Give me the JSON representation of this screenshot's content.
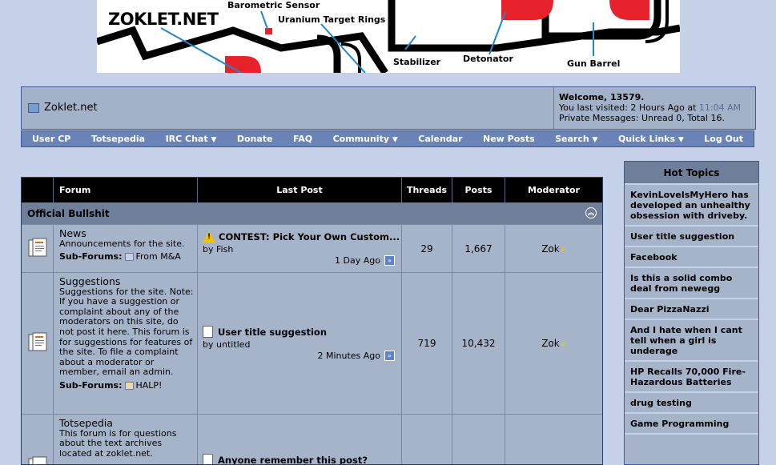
{
  "banner": {
    "site_title": "ZOKLET.NET",
    "labels": [
      "Barometric Sensor",
      "Uranium Target Rings",
      "Stabilizer",
      "Detonator",
      "Gun Barrel"
    ]
  },
  "header": {
    "site_name": "Zoklet.net",
    "welcome": "Welcome, 13579.",
    "last_visited_prefix": "You last visited: 2 Hours Ago at",
    "last_visited_time": "11:04 AM",
    "private_messages": "Private Messages: Unread 0, Total 16."
  },
  "nav": {
    "items": [
      "User CP",
      "Totsepedia",
      "IRC Chat",
      "Donate",
      "FAQ",
      "Community",
      "Calendar",
      "New Posts",
      "Search",
      "Quick Links",
      "Log Out"
    ]
  },
  "table": {
    "columns": [
      "Forum",
      "Last Post",
      "Threads",
      "Posts",
      "Moderator"
    ],
    "category": "Official Bullshit",
    "sub_forums_label": "Sub-Forums:",
    "by_label": "by",
    "forums": [
      {
        "title": "News",
        "description": "Announcements for the site.",
        "sub_forum": "From M&A",
        "last_post_title": "CONTEST: Pick Your Own Custom...",
        "last_post_by": "Fish",
        "last_post_time": "1 Day Ago",
        "threads": "29",
        "posts": "1,667",
        "moderator": "Zok"
      },
      {
        "title": "Suggestions",
        "description": "Suggestions for the site. Note: If you have a suggestion or complaint about any of the moderators on this site, do not post it here. This forum is for suggestions for features of the site. To file a complaint about a moderator or member, email an admin.",
        "sub_forum": "HALP!",
        "last_post_title": "User title suggestion",
        "last_post_by": "untitled",
        "last_post_time": "2 Minutes Ago",
        "threads": "719",
        "posts": "10,432",
        "moderator": "Zok"
      },
      {
        "title": "Totsepedia",
        "description": "This forum is for questions about the text archives located at zoklet.net.",
        "last_post_title": "Anyone remember this post?"
      }
    ]
  },
  "hot_topics": {
    "title": "Hot Topics",
    "items": [
      "KevinLoveIsMyHero has developed an unhealthy obsession with driveby.",
      "User title suggestion",
      "Facebook",
      "Is this a solid combo deal from newegg",
      "Dear PizzaNazzi",
      "And I hate when I cant tell when a girl is underage",
      "HP Recalls 70,000 Fire-Hazardous Batteries",
      "drug testing",
      "Game Programming"
    ]
  }
}
